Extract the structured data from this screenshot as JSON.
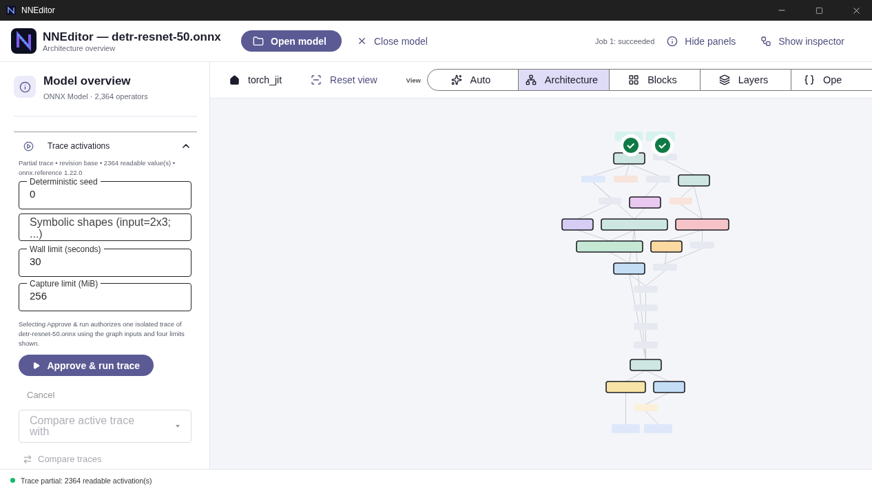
{
  "window": {
    "title": "NNEditor"
  },
  "header": {
    "title": "NNEditor — detr-resnet-50.onnx",
    "subtitle": "Architecture overview",
    "open_button": "Open model",
    "close_button": "Close model",
    "job_status": "Job 1: succeeded",
    "hide_panels": "Hide panels",
    "show_inspector": "Show inspector"
  },
  "overview": {
    "title": "Model overview",
    "subtitle": "ONNX Model · 2,364 operators"
  },
  "trace": {
    "title": "Trace activations",
    "expanded": true,
    "info": "Partial trace • revision base • 2364 readable value(s) • onnx.reference 1.22.0",
    "fields": [
      {
        "label": "Deterministic seed",
        "value": "0"
      },
      {
        "placeholder": "Symbolic shapes (input=2x3; ...)"
      },
      {
        "label": "Wall limit (seconds)",
        "value": "30"
      },
      {
        "label": "Capture limit (MiB)",
        "value": "256"
      }
    ],
    "note": "Selecting Approve & run authorizes one isolated trace of detr-resnet-50.onnx using the graph inputs and four limits shown.",
    "run_button": "Approve & run trace",
    "cancel_button": "Cancel",
    "compare_select": {
      "placeholder": "Compare active trace with",
      "disabled": true
    },
    "compare_button": {
      "label": "Compare traces",
      "disabled": true
    }
  },
  "toolbar": {
    "root": "torch_jit",
    "reset": "Reset view",
    "view_label": "View",
    "views": [
      {
        "label": "Auto",
        "selected": false
      },
      {
        "label": "Architecture",
        "selected": true
      },
      {
        "label": "Blocks",
        "selected": false
      },
      {
        "label": "Layers",
        "selected": false
      },
      {
        "label": "Ope",
        "selected": false
      }
    ]
  },
  "status_bar": {
    "text": "Trace partial: 2364 readable activation(s)"
  }
}
